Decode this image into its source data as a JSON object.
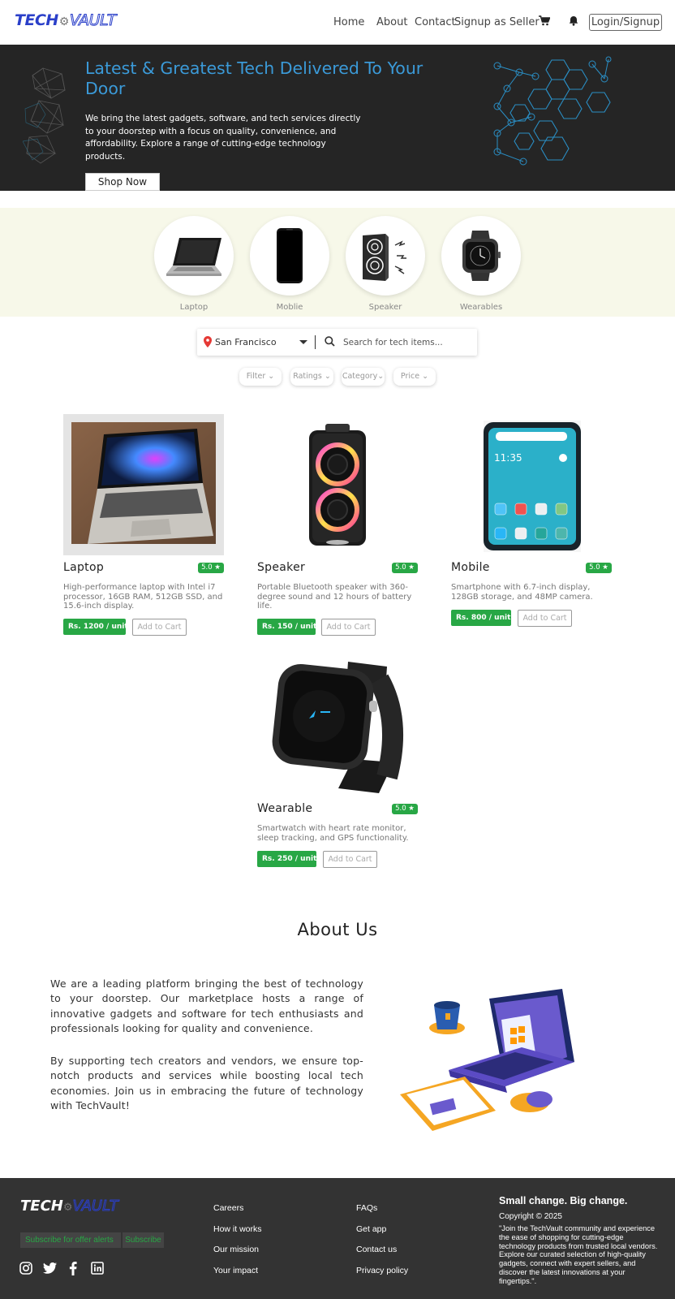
{
  "brand": {
    "part1": "TECH",
    "part2": "VAULT"
  },
  "nav": {
    "links": [
      "Home",
      "About",
      "Contact",
      "Signup as Seller"
    ],
    "login_label": "Login/Signup"
  },
  "hero": {
    "title": "Latest & Greatest Tech Delivered To Your Door",
    "text": "We bring the latest gadgets, software, and tech services directly to your doorstep with a focus on quality, convenience, and affordability. Explore a range of cutting-edge technology products.",
    "cta": "Shop Now"
  },
  "categories": [
    "Laptop",
    "Moblie",
    "Speaker",
    "Wearables"
  ],
  "search": {
    "location": "San Francisco",
    "placeholder": "Search for tech items..."
  },
  "filters": [
    "Filter",
    "Ratings",
    "Category",
    "Price"
  ],
  "products": [
    {
      "name": "Laptop",
      "rating": "5.0 ★",
      "desc": "High-performance laptop with Intel i7 processor, 16GB RAM, 512GB SSD, and 15.6-inch display.",
      "price": "Rs. 1200 / unit",
      "cart": "Add to Cart"
    },
    {
      "name": "Speaker",
      "rating": "5.0 ★",
      "desc": "Portable Bluetooth speaker with 360-degree sound and 12 hours of battery life.",
      "price": "Rs. 150 / unit",
      "cart": "Add to Cart"
    },
    {
      "name": "Mobile",
      "rating": "5.0 ★",
      "desc": "Smartphone with 6.7-inch display, 128GB storage, and 48MP camera.",
      "price": "Rs. 800 / unit",
      "cart": "Add to Cart"
    },
    {
      "name": "Wearable",
      "rating": "5.0 ★",
      "desc": "Smartwatch with heart rate monitor, sleep tracking, and GPS functionality.",
      "price": "Rs. 250 / unit",
      "cart": "Add to Cart"
    }
  ],
  "about": {
    "title": "About Us",
    "p1": "We are a leading platform bringing the best of technology to your doorstep. Our marketplace hosts a range of innovative gadgets and software for tech enthusiasts and professionals looking for quality and convenience.",
    "p2": "By supporting tech creators and vendors, we ensure top-notch products and services while boosting local tech economies. Join us in embracing the future of technology with TechVault!"
  },
  "footer": {
    "subscribe_label": "Subscribe for offer alerts",
    "subscribe_btn": "Subscribe",
    "col1": [
      "Careers",
      "How it works",
      "Our mission",
      "Your impact"
    ],
    "col2": [
      "FAQs",
      "Get app",
      "Contact us",
      "Privacy policy"
    ],
    "heading": "Small change. Big change.",
    "copyright": "Copyright © 2025",
    "quote": "\"Join the TechVault community and experience the ease of shopping for cutting-edge technology products from trusted local vendors. Explore our curated selection of high-quality gadgets, connect with expert sellers, and discover the latest innovations at your fingertips.\"."
  },
  "icons": {
    "cart": "cart-icon",
    "bell": "bell-icon",
    "location": "location-pin-icon",
    "search": "search-icon",
    "social": [
      "instagram-icon",
      "twitter-icon",
      "facebook-icon",
      "linkedin-icon"
    ]
  },
  "colors": {
    "accent": "#3b9ad8",
    "brand": "#2a3fc9",
    "green": "#28a745",
    "hero_bg": "#252525",
    "footer_bg": "#333333",
    "category_bg": "#f7f8e9"
  }
}
